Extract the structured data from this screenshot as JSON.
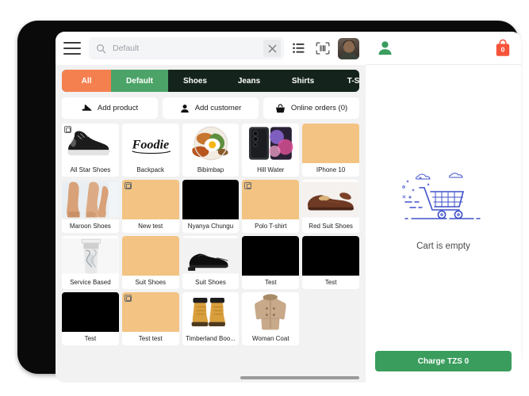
{
  "topbar": {
    "menu_icon": "hamburger-menu-icon",
    "search_icon": "search-icon",
    "search_value": "",
    "search_placeholder": "Default",
    "clear_icon": "close-icon",
    "list_view_icon": "list-view-icon",
    "barcode_icon": "barcode-scan-icon",
    "avatar_icon": "user-avatar"
  },
  "categories": [
    {
      "label": "All",
      "style": "tab-all",
      "active": true
    },
    {
      "label": "Default",
      "style": "tab-default",
      "active": false
    },
    {
      "label": "Shoes",
      "style": "tab-dark",
      "active": false
    },
    {
      "label": "Jeans",
      "style": "tab-dark",
      "active": false
    },
    {
      "label": "Shirts",
      "style": "tab-dark",
      "active": false
    },
    {
      "label": "T-Shi",
      "style": "tab-dark",
      "active": false
    }
  ],
  "actions": [
    {
      "label": "Add product",
      "icon": "shoe-icon"
    },
    {
      "label": "Add customer",
      "icon": "person-icon"
    },
    {
      "label": "Online orders (0)",
      "icon": "basket-icon"
    }
  ],
  "products": [
    {
      "name": "All Star Shoes",
      "thumb": "sneaker",
      "bg": "ph-white",
      "variant": true
    },
    {
      "name": "Backpack",
      "thumb": "foodie-logo",
      "bg": "ph-white",
      "variant": false
    },
    {
      "name": "Bibimbap",
      "thumb": "bibimbap",
      "bg": "ph-white",
      "variant": false
    },
    {
      "name": "Hill Water",
      "thumb": "phone",
      "bg": "ph-white",
      "variant": false
    },
    {
      "name": "IPhone 10",
      "thumb": "placeholder",
      "bg": "ph-tan",
      "variant": false
    },
    {
      "name": "Maroon Shoes",
      "thumb": "legs",
      "bg": "ph-grey",
      "variant": false
    },
    {
      "name": "New test",
      "thumb": "placeholder",
      "bg": "ph-tan",
      "variant": true
    },
    {
      "name": "Nyanya Chungu",
      "thumb": "placeholder",
      "bg": "ph-black",
      "variant": false
    },
    {
      "name": "Polo T-shirt",
      "thumb": "placeholder",
      "bg": "ph-tan",
      "variant": true
    },
    {
      "name": "Red Suit Shoes",
      "thumb": "brownshoe",
      "bg": "ph-white",
      "variant": false
    },
    {
      "name": "Service Based",
      "thumb": "cup",
      "bg": "ph-white",
      "variant": false
    },
    {
      "name": "Suit Shoes",
      "thumb": "placeholder",
      "bg": "ph-tan",
      "variant": false
    },
    {
      "name": "Suit Shoes",
      "thumb": "blackshoe",
      "bg": "ph-white",
      "variant": false
    },
    {
      "name": "Test",
      "thumb": "placeholder",
      "bg": "ph-black",
      "variant": false
    },
    {
      "name": "Test",
      "thumb": "placeholder",
      "bg": "ph-black",
      "variant": false
    },
    {
      "name": "Test",
      "thumb": "placeholder",
      "bg": "ph-black",
      "variant": false
    },
    {
      "name": "Test test",
      "thumb": "placeholder",
      "bg": "ph-tan",
      "variant": true
    },
    {
      "name": "Timberland Boo...",
      "thumb": "boot",
      "bg": "ph-white",
      "variant": false
    },
    {
      "name": "Woman Coat",
      "thumb": "coat",
      "bg": "ph-white",
      "variant": false
    }
  ],
  "cart": {
    "customer_icon": "person-icon",
    "bag_icon": "shopping-bag-icon",
    "bag_count": "0",
    "empty_illustration": "empty-cart-illustration",
    "empty_text": "Cart is empty",
    "charge_label": "Charge TZS 0"
  },
  "colors": {
    "accent_orange": "#f4804f",
    "accent_green": "#4ba368",
    "tab_dark": "#14241c",
    "charge_green": "#3a9d5d",
    "badge_red": "#f5543a",
    "placeholder_tan": "#f2c382",
    "illustration_blue": "#3f51c9"
  }
}
